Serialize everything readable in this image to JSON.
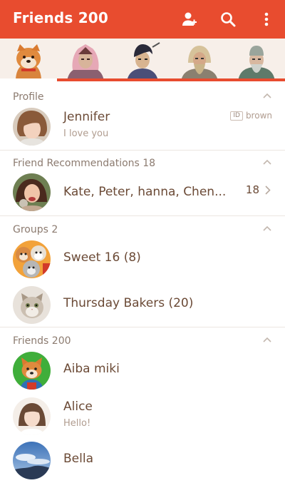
{
  "header": {
    "title": "Friends 200",
    "accent_color": "#e84c2f",
    "icons": [
      "add-friend-icon",
      "search-icon",
      "more-vertical-icon"
    ]
  },
  "tabs": [
    {
      "name": "shiba-dog-character"
    },
    {
      "name": "samurai-warrior-character"
    },
    {
      "name": "ninja-character"
    },
    {
      "name": "bearded-warrior-character"
    },
    {
      "name": "old-master-character"
    }
  ],
  "sections": {
    "profile": {
      "label": "Profile"
    },
    "recommendations": {
      "label": "Friend Recommendations 18"
    },
    "groups": {
      "label": "Groups 2"
    },
    "friends": {
      "label": "Friends 200"
    }
  },
  "profile": {
    "name": "Jennifer",
    "status": "I love you",
    "id_badge": "ID",
    "id_value": "brown"
  },
  "recommendations": {
    "names": "Kate, Peter, hanna, Chen...",
    "count": "18"
  },
  "groups": [
    {
      "name": "Sweet 16 (8)"
    },
    {
      "name": "Thursday Bakers (20)"
    }
  ],
  "friends": [
    {
      "name": "Aiba miki",
      "status": ""
    },
    {
      "name": "Alice",
      "status": "Hello!"
    },
    {
      "name": "Bella",
      "status": ""
    }
  ]
}
